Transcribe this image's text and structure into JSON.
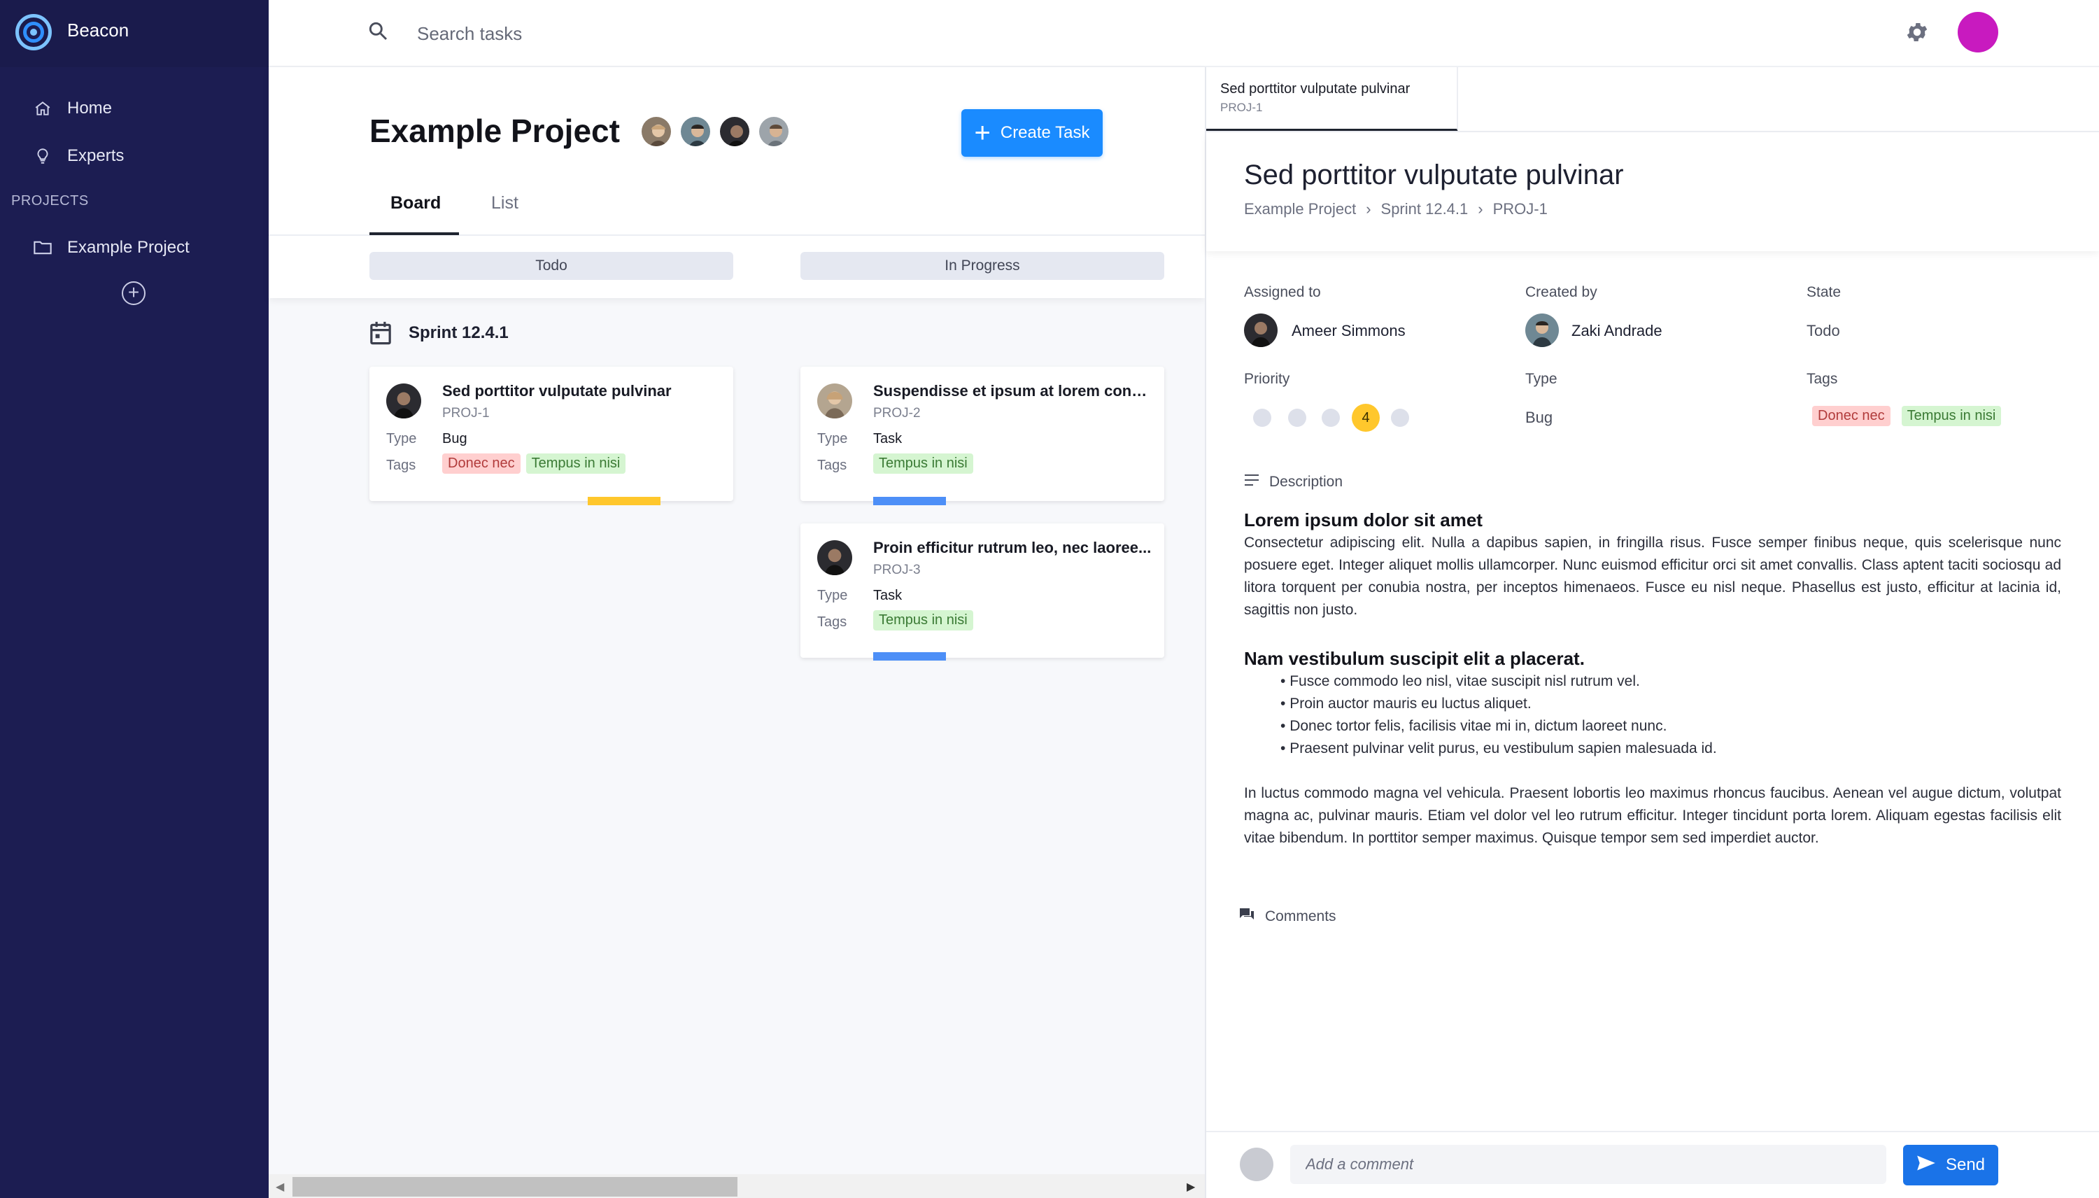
{
  "sidebar": {
    "brand": "Beacon",
    "nav": [
      {
        "label": "Home",
        "icon": "home-icon"
      },
      {
        "label": "Experts",
        "icon": "lightbulb-icon"
      }
    ],
    "section_label": "PROJECTS",
    "projects": [
      {
        "label": "Example Project",
        "icon": "folder-icon"
      }
    ],
    "add_label": "+"
  },
  "topbar": {
    "search_placeholder": "Search tasks",
    "user_avatar_color": "#c81abf"
  },
  "project": {
    "title": "Example Project",
    "create_label": "Create Task",
    "tabs": [
      {
        "label": "Board",
        "active": true
      },
      {
        "label": "List",
        "active": false
      }
    ],
    "columns": [
      "Todo",
      "In Progress"
    ],
    "sprint": "Sprint 12.4.1",
    "cards": [
      {
        "title": "Sed porttitor vulputate pulvinar",
        "id": "PROJ-1",
        "type_label": "Type",
        "type": "Bug",
        "tags_label": "Tags",
        "tags": [
          "Donec nec",
          "Tempus in nisi"
        ],
        "priority_color": "#ffc72c"
      },
      {
        "title": "Suspendisse et ipsum at lorem condi...",
        "id": "PROJ-2",
        "type_label": "Type",
        "type": "Task",
        "tags_label": "Tags",
        "tags": [
          "Tempus in nisi"
        ],
        "priority_color": "#4d8ff7"
      },
      {
        "title": "Proin efficitur rutrum leo, nec laoree...",
        "id": "PROJ-3",
        "type_label": "Type",
        "type": "Task",
        "tags_label": "Tags",
        "tags": [
          "Tempus in nisi"
        ],
        "priority_color": "#4d8ff7"
      }
    ]
  },
  "detail": {
    "tab_title": "Sed porttitor vulputate pulvinar",
    "tab_id": "PROJ-1",
    "title": "Sed porttitor vulputate pulvinar",
    "breadcrumb": [
      "Example Project",
      "Sprint 12.4.1",
      "PROJ-1"
    ],
    "assigned_label": "Assigned to",
    "assigned": "Ameer Simmons",
    "created_label": "Created by",
    "created": "Zaki Andrade",
    "state_label": "State",
    "state": "Todo",
    "priority_label": "Priority",
    "priority": "4",
    "type_label": "Type",
    "type": "Bug",
    "tags_label": "Tags",
    "tags": [
      "Donec nec",
      "Tempus in nisi"
    ],
    "description_label": "Description",
    "desc_h1": "Lorem ipsum dolor sit amet",
    "desc_p1": "Consectetur adipiscing elit. Nulla a dapibus sapien, in fringilla risus. Fusce semper finibus neque, quis scelerisque nunc posuere eget. Integer aliquet mollis ullamcorper. Nunc euismod efficitur orci sit amet convallis. Class aptent taciti sociosqu ad litora torquent per conubia nostra, per inceptos himenaeos. Fusce eu nisl neque. Phasellus est justo, efficitur at lacinia id, sagittis non justo.",
    "desc_h2": "Nam vestibulum suscipit elit a placerat.",
    "desc_list": [
      "Fusce commodo leo nisl, vitae suscipit nisl rutrum vel.",
      "Proin auctor mauris eu luctus aliquet.",
      "Donec tortor felis, facilisis vitae mi in, dictum laoreet nunc.",
      "Praesent pulvinar velit purus, eu vestibulum sapien malesuada id."
    ],
    "desc_p2": "In luctus commodo magna vel vehicula. Praesent lobortis leo maximus rhoncus faucibus. Aenean vel augue dictum, volutpat magna ac, pulvinar mauris. Etiam vel dolor vel leo rutrum efficitur. Integer tincidunt porta lorem. Aliquam egestas facilisis elit vitae bibendum. In porttitor semper maximus. Quisque tempor sem sed imperdiet auctor.",
    "comments_label": "Comments",
    "comment_placeholder": "Add a comment",
    "send_label": "Send"
  }
}
